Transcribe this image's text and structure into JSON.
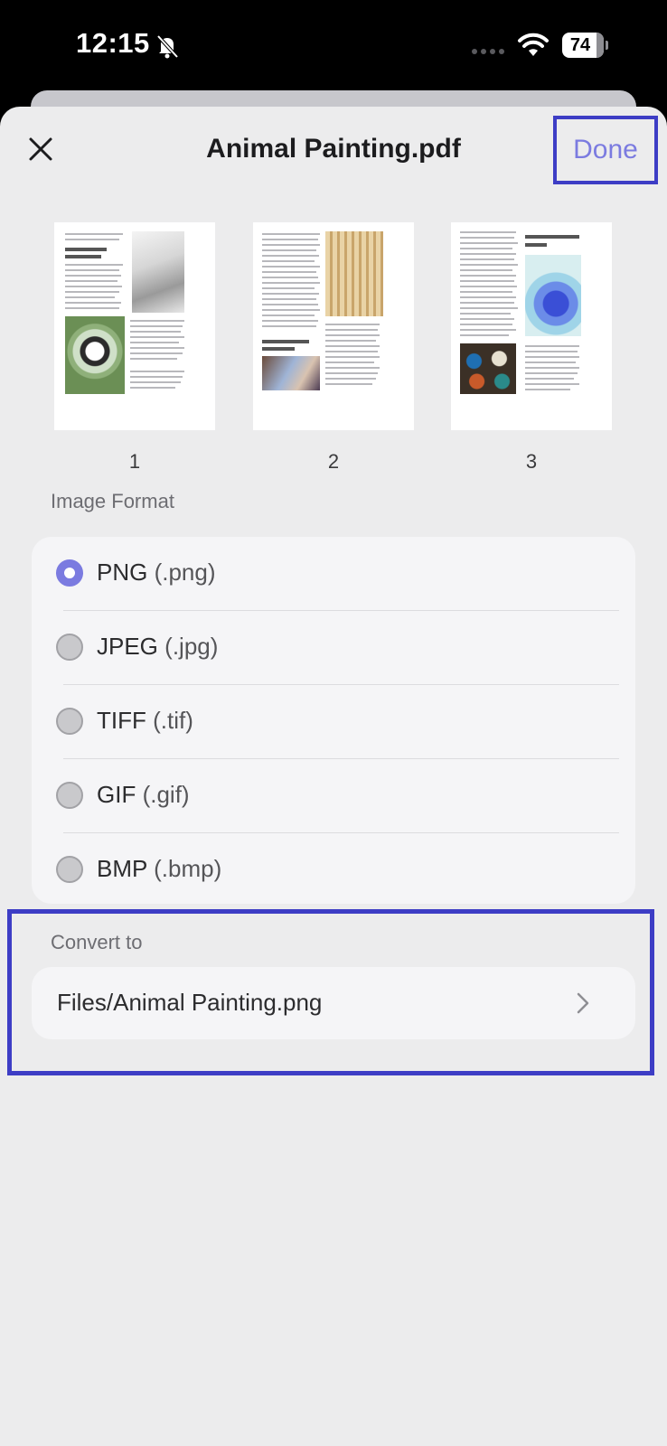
{
  "status_bar": {
    "time": "12:15",
    "battery": "74",
    "icons": [
      "bell-slash-icon",
      "signal-icon",
      "wifi-icon",
      "battery-icon"
    ]
  },
  "header": {
    "title": "Animal Painting.pdf",
    "done_label": "Done",
    "close_icon": "close-icon"
  },
  "pages": [
    {
      "number": "1",
      "heading": "How to Draw Our Favorite Pets"
    },
    {
      "number": "2",
      "heading": "Animals are a part of our daily life"
    },
    {
      "number": "3",
      "heading": "Different Painting Styles"
    }
  ],
  "image_format": {
    "label": "Image Format",
    "options": [
      {
        "name": "PNG",
        "ext": "(.png)",
        "selected": true
      },
      {
        "name": "JPEG",
        "ext": "(.jpg)",
        "selected": false
      },
      {
        "name": "TIFF",
        "ext": "(.tif)",
        "selected": false
      },
      {
        "name": "GIF",
        "ext": "(.gif)",
        "selected": false
      },
      {
        "name": "BMP",
        "ext": "(.bmp)",
        "selected": false
      }
    ]
  },
  "convert": {
    "label": "Convert to",
    "path": "Files/Animal Painting.png"
  },
  "colors": {
    "accent": "#7b7be0",
    "highlight_box": "#3d3dc5",
    "sheet_background": "#ececed"
  }
}
